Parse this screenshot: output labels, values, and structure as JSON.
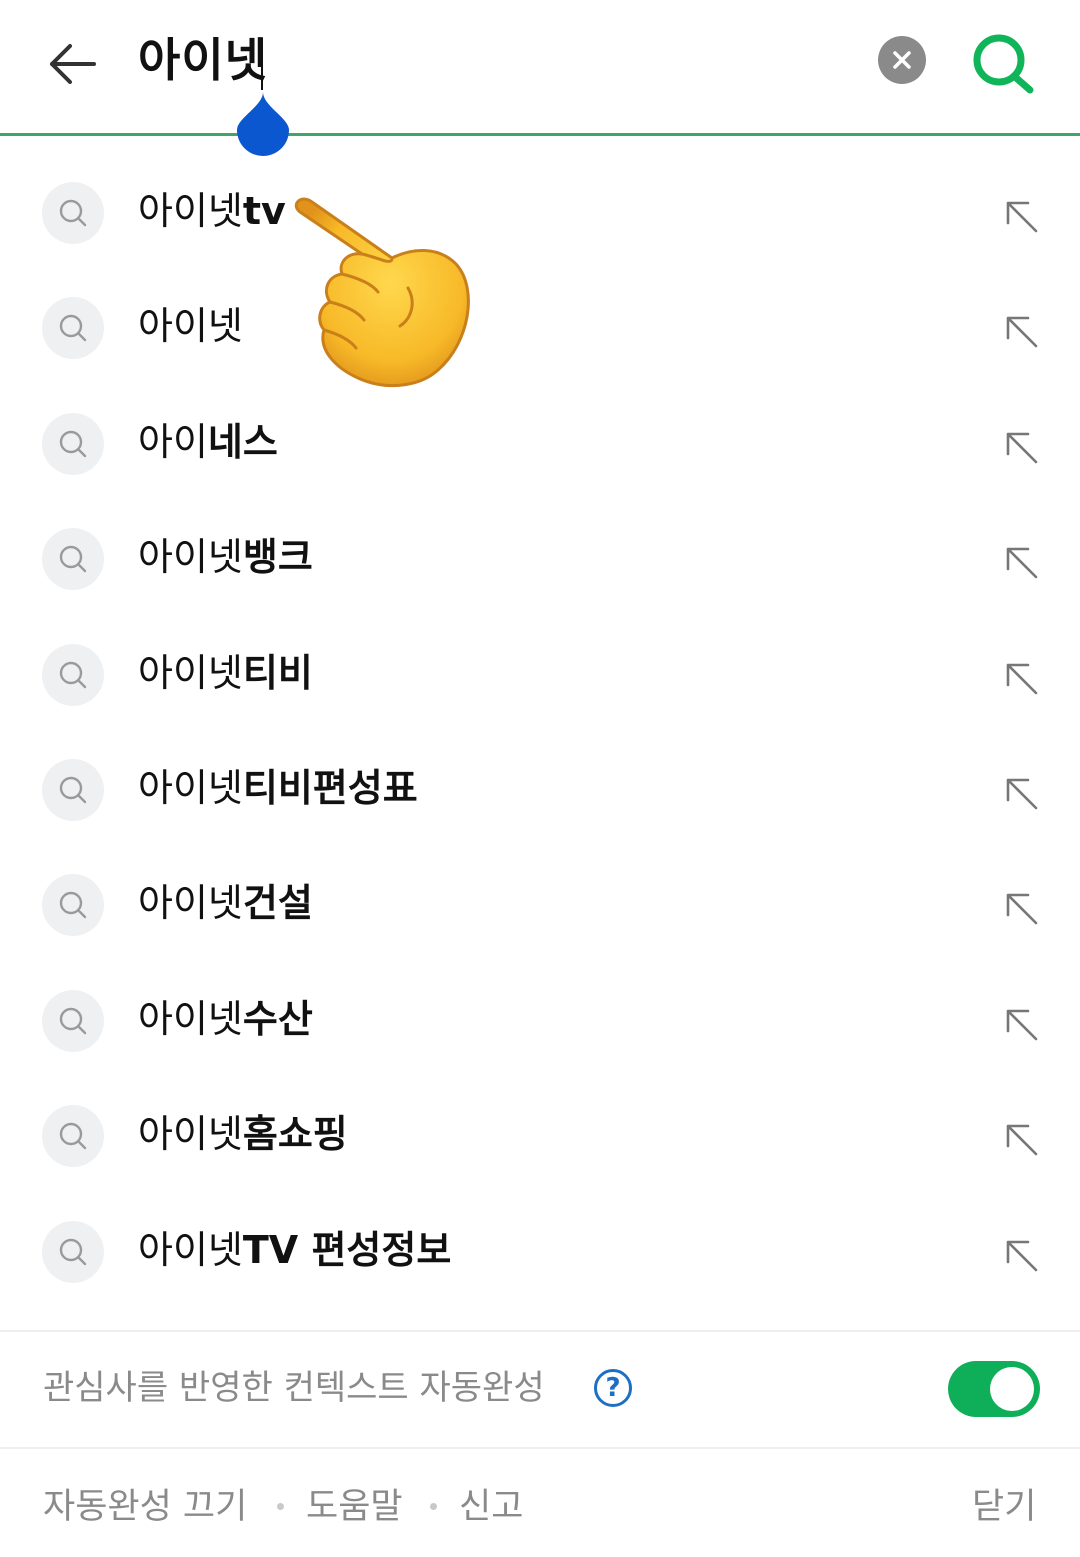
{
  "search": {
    "query": "아이넷",
    "back_icon": "arrow-left-icon",
    "clear_icon": "close-icon",
    "submit_icon": "search-icon",
    "accent_color": "#3fa66b",
    "handle_color": "#0b57d0"
  },
  "suggestions": [
    {
      "typed": "아이넷",
      "rest": "tv"
    },
    {
      "typed": "아이넷",
      "rest": ""
    },
    {
      "typed": "아이",
      "rest": "네스"
    },
    {
      "typed": "아이넷",
      "rest": "뱅크"
    },
    {
      "typed": "아이넷",
      "rest": "티비"
    },
    {
      "typed": "아이넷",
      "rest": "티비편성표"
    },
    {
      "typed": "아이넷",
      "rest": "건설"
    },
    {
      "typed": "아이넷",
      "rest": "수산"
    },
    {
      "typed": "아이넷",
      "rest": "홈쇼핑"
    },
    {
      "typed": "아이넷",
      "rest": "TV 편성정보"
    }
  ],
  "suggestion_icons": {
    "leading": "search-icon",
    "trailing": "arrow-up-left-icon"
  },
  "overlay": {
    "icon": "pointing-hand-icon"
  },
  "context": {
    "label": "관심사를 반영한 컨텍스트 자동완성",
    "help_symbol": "?",
    "toggle_on": true,
    "toggle_color": "#0fae58"
  },
  "footer": {
    "off_label": "자동완성 끄기",
    "help_label": "도움말",
    "report_label": "신고",
    "close_label": "닫기"
  }
}
